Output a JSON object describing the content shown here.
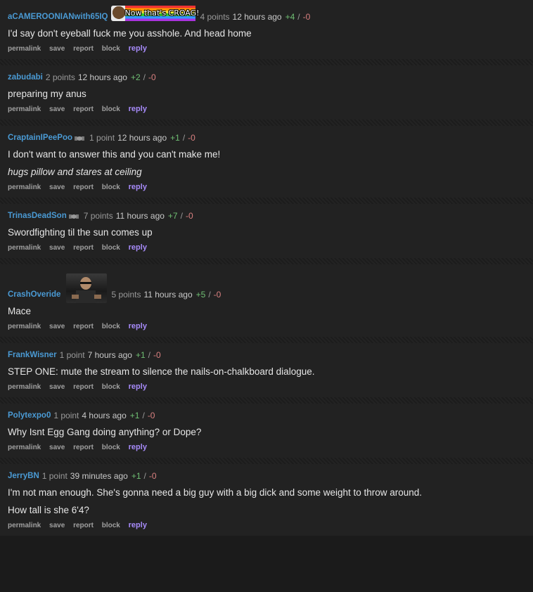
{
  "actions": {
    "permalink": "permalink",
    "save": "save",
    "report": "report",
    "block": "block",
    "reply": "reply"
  },
  "comments": [
    {
      "author": "aCAMEROONIANwith65IQ",
      "flair_text": "Now that's CROAG!",
      "score": "4 points",
      "time": "12 hours ago",
      "up": "+4",
      "down": "-0",
      "paragraphs": [
        "I'd say don't eyeball fuck me you asshole. And head home"
      ]
    },
    {
      "author": "zabudabi",
      "score": "2 points",
      "time": "12 hours ago",
      "up": "+2",
      "down": "-0",
      "paragraphs": [
        "preparing my anus"
      ]
    },
    {
      "author": "CraptainIPeePoo",
      "score": "1 point",
      "time": "12 hours ago",
      "up": "+1",
      "down": "-0",
      "paragraphs": [
        "I don't want to answer this and you can't make me!",
        "hugs pillow and stares at ceiling"
      ]
    },
    {
      "author": "TrinasDeadSon",
      "score": "7 points",
      "time": "11 hours ago",
      "up": "+7",
      "down": "-0",
      "paragraphs": [
        "Swordfighting til the sun comes up"
      ]
    },
    {
      "author": "CrashOveride",
      "score": "5 points",
      "time": "11 hours ago",
      "up": "+5",
      "down": "-0",
      "paragraphs": [
        "Mace"
      ]
    },
    {
      "author": "FrankWisner",
      "score": "1 point",
      "time": "7 hours ago",
      "up": "+1",
      "down": "-0",
      "paragraphs": [
        "STEP ONE: mute the stream to silence the nails-on-chalkboard dialogue."
      ]
    },
    {
      "author": "Polytexpo0",
      "score": "1 point",
      "time": "4 hours ago",
      "up": "+1",
      "down": "-0",
      "paragraphs": [
        "Why Isnt Egg Gang doing anything? or Dope?"
      ]
    },
    {
      "author": "JerryBN",
      "score": "1 point",
      "time": "39 minutes ago",
      "up": "+1",
      "down": "-0",
      "paragraphs": [
        "I'm not man enough. She's gonna need a big guy with a big dick and some weight to throw around.",
        "How tall is she 6'4?"
      ]
    }
  ]
}
